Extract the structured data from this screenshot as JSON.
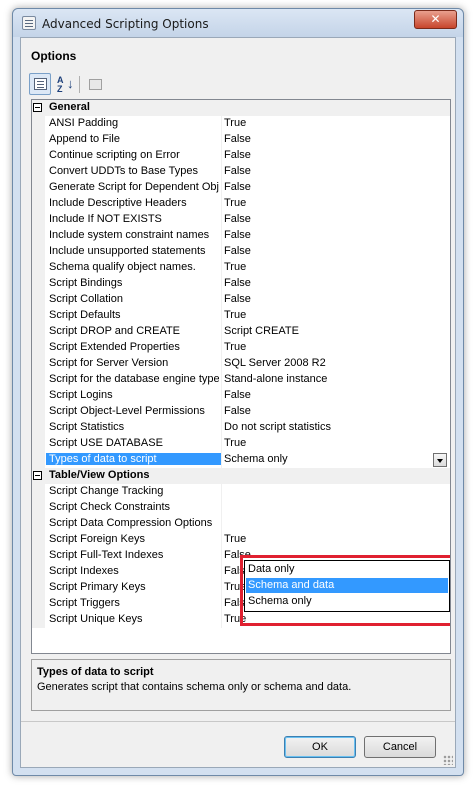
{
  "window": {
    "title": "Advanced Scripting Options",
    "close_glyph": "✕"
  },
  "options_heading": "Options",
  "toolbar": {
    "sort_az": "A\nZ",
    "sort_arrow": "↓"
  },
  "categories": [
    {
      "label": "General",
      "collapse_glyph": "−"
    },
    {
      "label": "Table/View Options",
      "collapse_glyph": "−"
    }
  ],
  "general": [
    {
      "name": "ANSI Padding",
      "value": "True"
    },
    {
      "name": "Append to File",
      "value": "False"
    },
    {
      "name": "Continue scripting on Error",
      "value": "False"
    },
    {
      "name": "Convert UDDTs to Base Types",
      "value": "False"
    },
    {
      "name": "Generate Script for Dependent Obje",
      "value": "False"
    },
    {
      "name": "Include Descriptive Headers",
      "value": "True"
    },
    {
      "name": "Include If NOT EXISTS",
      "value": "False"
    },
    {
      "name": "Include system constraint names",
      "value": "False"
    },
    {
      "name": "Include unsupported statements",
      "value": "False"
    },
    {
      "name": "Schema qualify object names.",
      "value": "True"
    },
    {
      "name": "Script Bindings",
      "value": "False"
    },
    {
      "name": "Script Collation",
      "value": "False"
    },
    {
      "name": "Script Defaults",
      "value": "True"
    },
    {
      "name": "Script DROP and CREATE",
      "value": "Script CREATE"
    },
    {
      "name": "Script Extended Properties",
      "value": "True"
    },
    {
      "name": "Script for Server Version",
      "value": "SQL Server 2008 R2"
    },
    {
      "name": "Script for the database engine type",
      "value": "Stand-alone instance"
    },
    {
      "name": "Script Logins",
      "value": "False"
    },
    {
      "name": "Script Object-Level Permissions",
      "value": "False"
    },
    {
      "name": "Script Statistics",
      "value": "Do not script statistics"
    },
    {
      "name": "Script USE DATABASE",
      "value": "True"
    },
    {
      "name": "Types of data to script",
      "value": "Schema only"
    }
  ],
  "table_view": [
    {
      "name": "Script Change Tracking",
      "value": ""
    },
    {
      "name": "Script Check Constraints",
      "value": ""
    },
    {
      "name": "Script Data Compression Options",
      "value": ""
    },
    {
      "name": "Script Foreign Keys",
      "value": "True"
    },
    {
      "name": "Script Full-Text Indexes",
      "value": "False"
    },
    {
      "name": "Script Indexes",
      "value": "False"
    },
    {
      "name": "Script Primary Keys",
      "value": "True"
    },
    {
      "name": "Script Triggers",
      "value": "False"
    },
    {
      "name": "Script Unique Keys",
      "value": "True"
    }
  ],
  "dropdown": {
    "options": [
      "Data only",
      "Schema and data",
      "Schema only"
    ],
    "highlighted": "Schema and data"
  },
  "description": {
    "title": "Types of data to script",
    "text": "Generates script that contains schema only or schema and data."
  },
  "buttons": {
    "ok": "OK",
    "cancel": "Cancel"
  },
  "colors": {
    "selection": "#3399ff",
    "highlight_box": "#e02030"
  }
}
